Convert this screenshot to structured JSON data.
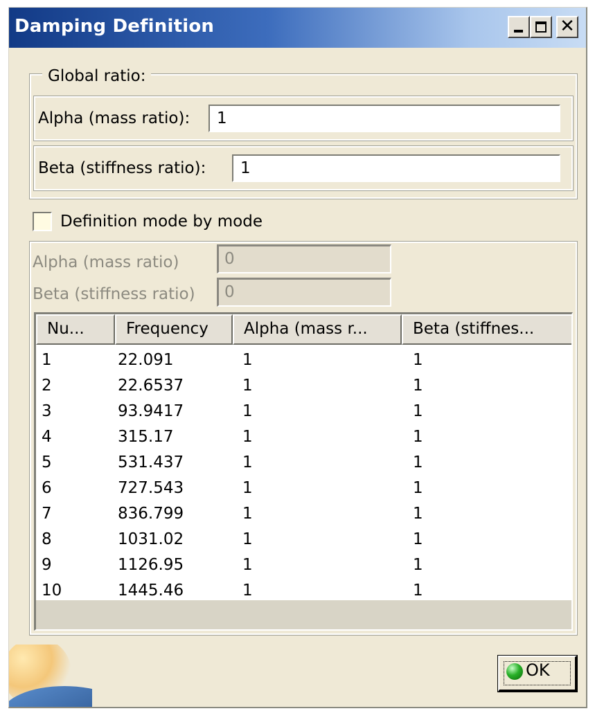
{
  "window": {
    "title": "Damping Definition"
  },
  "global_ratio": {
    "legend": "Global ratio:",
    "alpha_label": "Alpha (mass ratio):",
    "alpha_value": "1",
    "beta_label": "Beta (stiffness ratio):",
    "beta_value": "1"
  },
  "mode_by_mode": {
    "checkbox_label": "Definition mode by mode",
    "checked": false,
    "alpha_label": "Alpha (mass ratio)",
    "alpha_value": "0",
    "beta_label": "Beta (stiffness ratio)",
    "beta_value": "0"
  },
  "table": {
    "columns": [
      "Nu...",
      "Frequency",
      "Alpha (mass r...",
      "Beta (stiffnes..."
    ],
    "rows": [
      [
        "1",
        "22.091",
        "1",
        "1"
      ],
      [
        "2",
        "22.6537",
        "1",
        "1"
      ],
      [
        "3",
        "93.9417",
        "1",
        "1"
      ],
      [
        "4",
        "315.17",
        "1",
        "1"
      ],
      [
        "5",
        "531.437",
        "1",
        "1"
      ],
      [
        "6",
        "727.543",
        "1",
        "1"
      ],
      [
        "7",
        "836.799",
        "1",
        "1"
      ],
      [
        "8",
        "1031.02",
        "1",
        "1"
      ],
      [
        "9",
        "1126.95",
        "1",
        "1"
      ],
      [
        "10",
        "1445.46",
        "1",
        "1"
      ]
    ]
  },
  "buttons": {
    "ok_label": "OK"
  },
  "colors": {
    "dialog_background": "#efe9d6",
    "titlebar_start": "#123a86",
    "titlebar_end": "#c8dcf4",
    "disabled_text": "#8c8a80",
    "ok_icon": "#28b028"
  }
}
